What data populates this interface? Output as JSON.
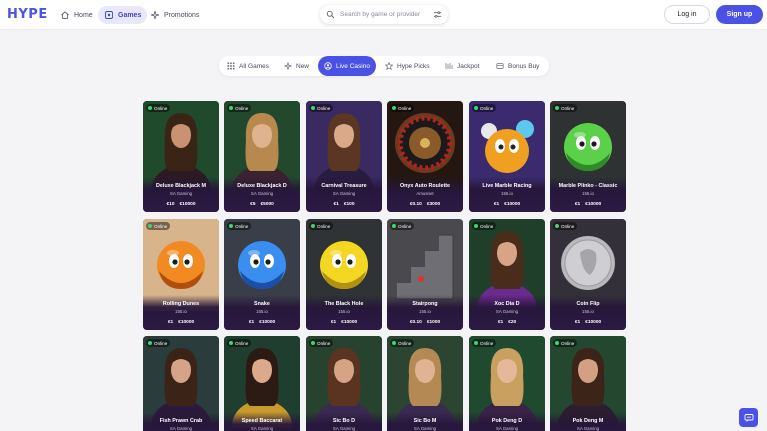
{
  "header": {
    "logo": "HYPE",
    "nav": [
      {
        "label": "Home",
        "icon": "home-icon",
        "active": false
      },
      {
        "label": "Games",
        "icon": "games-icon",
        "active": true
      },
      {
        "label": "Promotions",
        "icon": "promotions-icon",
        "active": false
      }
    ],
    "search": {
      "placeholder": "Search by game or provider",
      "value": ""
    },
    "login_label": "Log in",
    "signup_label": "Sign up"
  },
  "tabs": [
    {
      "label": "All Games",
      "icon": "grid-icon",
      "active": false
    },
    {
      "label": "New",
      "icon": "sparkle-icon",
      "active": false
    },
    {
      "label": "Live Casino",
      "icon": "live-icon",
      "active": true
    },
    {
      "label": "Hype Picks",
      "icon": "star-icon",
      "active": false
    },
    {
      "label": "Jackpot",
      "icon": "jackpot-icon",
      "active": false
    },
    {
      "label": "Bonus Buy",
      "icon": "bonus-icon",
      "active": false
    }
  ],
  "badge_label": "Online",
  "games": [
    {
      "title": "Deluxe Blackjack M",
      "provider": "SA Gaming",
      "min": "€10",
      "max": "€10000",
      "art": "dealer",
      "bg": "#1f4a2c",
      "skin": "#c99272",
      "hair": "#3a2416",
      "top": "#2b1a24"
    },
    {
      "title": "Deluxe Blackjack D",
      "provider": "SA Gaming",
      "min": "€5",
      "max": "€5000",
      "art": "dealer",
      "bg": "#22492e",
      "skin": "#e0b38f",
      "hair": "#b8894f",
      "top": "#3a2330"
    },
    {
      "title": "Carnival Treasure",
      "provider": "SA Gaming",
      "min": "€1",
      "max": "€100",
      "art": "dealer",
      "bg": "#3a2a62",
      "skin": "#d9a98a",
      "hair": "#5a3623",
      "top": "#2a1b40"
    },
    {
      "title": "Onyx Auto Roulette",
      "provider": "Amusnet",
      "min": "€0.10",
      "max": "€3000",
      "art": "roulette",
      "bg": "#241712"
    },
    {
      "title": "Live Marble Racing",
      "provider": "155.io",
      "min": "€1",
      "max": "€10000",
      "art": "marbles",
      "bg": "#3b2a6e"
    },
    {
      "title": "Marble Plinko - Classic",
      "provider": "155.io",
      "min": "€1",
      "max": "€10000",
      "art": "ball",
      "bg": "#2e3233",
      "ball": "#5bd14a",
      "shade": "#2f8a2a"
    },
    {
      "title": "Rolling Dunes",
      "provider": "155.io",
      "min": "€1",
      "max": "€10000",
      "art": "ball",
      "bg": "#d8b48c",
      "ball": "#f28a22",
      "shade": "#b04f0c"
    },
    {
      "title": "Snake",
      "provider": "155.io",
      "min": "€1",
      "max": "€10000",
      "art": "ball",
      "bg": "#3a3e48",
      "ball": "#3a8ef0",
      "shade": "#1b4fa8"
    },
    {
      "title": "The Black Hole",
      "provider": "155.io",
      "min": "€1",
      "max": "€10000",
      "art": "ball",
      "bg": "#2f3336",
      "ball": "#f4d722",
      "shade": "#b39110"
    },
    {
      "title": "Stairpong",
      "provider": "155.io",
      "min": "€0.10",
      "max": "€1000",
      "art": "stairs",
      "bg": "#4a4a4e"
    },
    {
      "title": "Xoc Dia D",
      "provider": "SA Gaming",
      "min": "€1",
      "max": "€20",
      "art": "dealer",
      "bg": "#203f2a",
      "skin": "#d8a487",
      "hair": "#4a2c1a",
      "top": "#6b2a8e"
    },
    {
      "title": "Coin Flip",
      "provider": "155.io",
      "min": "€1",
      "max": "€10000",
      "art": "coin",
      "bg": "#34303a"
    },
    {
      "title": "Fish Prawn Crab",
      "provider": "SA Gaming",
      "min": "",
      "max": "",
      "art": "dealer",
      "bg": "#2a3d3c",
      "skin": "#d5a488",
      "hair": "#3b2318",
      "top": "#2c1a3c"
    },
    {
      "title": "Speed Baccarat",
      "provider": "SA Gaming",
      "min": "",
      "max": "",
      "art": "dealer",
      "bg": "#1f3e30",
      "skin": "#dca98b",
      "hair": "#2b1b14",
      "top": "#c79a2a"
    },
    {
      "title": "Sic Bo D",
      "provider": "SA Gaming",
      "min": "",
      "max": "",
      "art": "dealer",
      "bg": "#27422e",
      "skin": "#d7a385",
      "hair": "#5a3421",
      "top": "#3a2a52"
    },
    {
      "title": "Sic Bo M",
      "provider": "SA Gaming",
      "min": "",
      "max": "",
      "art": "dealer",
      "bg": "#2b4532",
      "skin": "#e0b394",
      "hair": "#b48954",
      "top": "#3a2a52"
    },
    {
      "title": "Pok Deng D",
      "provider": "SA Gaming",
      "min": "",
      "max": "",
      "art": "dealer",
      "bg": "#1f4a30",
      "skin": "#e4b898",
      "hair": "#c9a060",
      "top": "#3b2348"
    },
    {
      "title": "Pok Deng M",
      "provider": "SA Gaming",
      "min": "",
      "max": "",
      "art": "dealer",
      "bg": "#24482f",
      "skin": "#d4a084",
      "hair": "#3c2418",
      "top": "#2d1d30"
    }
  ]
}
